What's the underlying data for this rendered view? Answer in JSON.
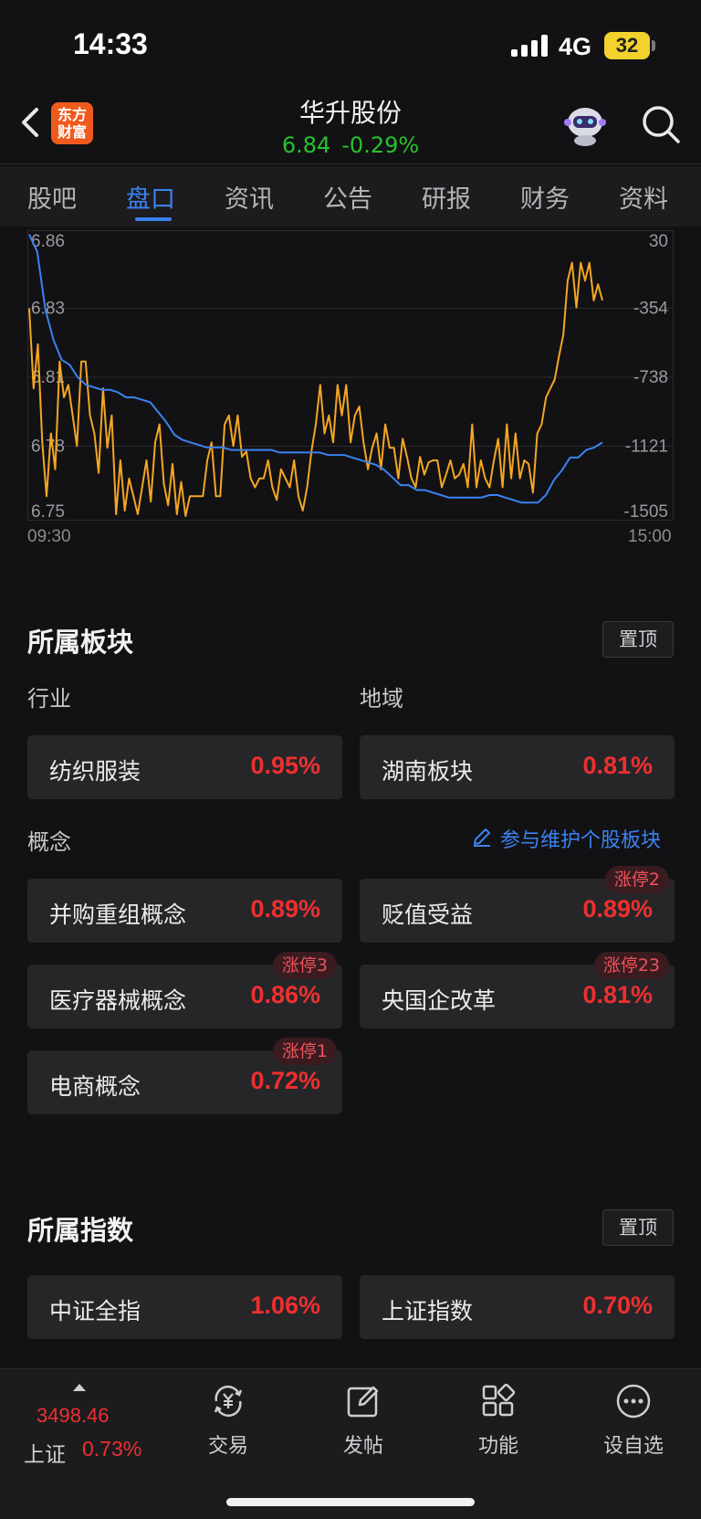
{
  "status_bar": {
    "time": "14:33",
    "network": "4G",
    "battery": "32"
  },
  "header": {
    "logo_line1": "东方",
    "logo_line2": "财富",
    "stock_name": "华升股份",
    "price": "6.84",
    "change_pct": "-0.29%"
  },
  "tabs": [
    "股吧",
    "盘口",
    "资讯",
    "公告",
    "研报",
    "财务",
    "资料"
  ],
  "active_tab": "盘口",
  "chart_data": {
    "type": "line",
    "x_start_label": "09:30",
    "x_end_label": "15:00",
    "left_axis_ticks": [
      "6.86",
      "6.83",
      "6.81",
      "6.78",
      "6.75"
    ],
    "right_axis_ticks": [
      "30",
      "-354",
      "-738",
      "-1121",
      "-1505"
    ],
    "left_range": [
      6.75,
      6.86
    ],
    "right_range": [
      -1505,
      30
    ],
    "grid": true,
    "series": [
      {
        "color": "#f5a623",
        "axis": "right",
        "values": [
          -354,
          -800,
          -554,
          -1100,
          -1400,
          -1050,
          -1250,
          -650,
          -850,
          -780,
          -950,
          -1120,
          -650,
          -650,
          -950,
          -1050,
          -1270,
          -800,
          -1130,
          -950,
          -1500,
          -1200,
          -1480,
          -1300,
          -1400,
          -1500,
          -1350,
          -1200,
          -1430,
          -1100,
          -1000,
          -1330,
          -1450,
          -1220,
          -1500,
          -1320,
          -1510,
          -1400,
          -1400,
          -1400,
          -1400,
          -1200,
          -1100,
          -1400,
          -1400,
          -1000,
          -950,
          -1120,
          -950,
          -1180,
          -1150,
          -1300,
          -1350,
          -1300,
          -1300,
          -1200,
          -1350,
          -1420,
          -1250,
          -1300,
          -1350,
          -1200,
          -1400,
          -1480,
          -1350,
          -1150,
          -1000,
          -780,
          -1050,
          -950,
          -1100,
          -780,
          -950,
          -780,
          -1100,
          -950,
          -900,
          -1100,
          -1250,
          -1130,
          -1050,
          -1250,
          -1000,
          -1130,
          -1130,
          -1300,
          -1080,
          -1180,
          -1300,
          -1350,
          -1180,
          -1280,
          -1210,
          -1200,
          -1200,
          -1350,
          -1280,
          -1200,
          -1300,
          -1280,
          -1220,
          -1350,
          -1000,
          -1350,
          -1200,
          -1300,
          -1350,
          -1200,
          -1080,
          -1350,
          -1000,
          -1300,
          -1050,
          -1300,
          -1200,
          -1220,
          -1380,
          -1050,
          -1000,
          -850,
          -800,
          -750,
          -620,
          -500,
          -200,
          -100,
          -350,
          -100,
          -200,
          -100,
          -310,
          -220,
          -310
        ]
      },
      {
        "color": "#3b82f0",
        "axis": "left",
        "values": [
          6.862,
          6.855,
          6.832,
          6.82,
          6.812,
          6.81,
          6.805,
          6.802,
          6.801,
          6.8,
          6.8,
          6.799,
          6.797,
          6.797,
          6.796,
          6.795,
          6.791,
          6.787,
          6.782,
          6.78,
          6.779,
          6.778,
          6.777,
          6.777,
          6.777,
          6.776,
          6.776,
          6.776,
          6.776,
          6.776,
          6.776,
          6.775,
          6.775,
          6.775,
          6.775,
          6.775,
          6.775,
          6.774,
          6.774,
          6.774,
          6.773,
          6.772,
          6.771,
          6.77,
          6.768,
          6.765,
          6.762,
          6.762,
          6.76,
          6.76,
          6.759,
          6.758,
          6.757,
          6.757,
          6.757,
          6.757,
          6.757,
          6.758,
          6.758,
          6.757,
          6.756,
          6.755,
          6.755,
          6.755,
          6.758,
          6.764,
          6.768,
          6.773,
          6.773,
          6.776,
          6.777,
          6.779
        ]
      }
    ]
  },
  "sectors": {
    "title": "所属板块",
    "pin_label": "置顶",
    "industry_label": "行业",
    "region_label": "地域",
    "industry": {
      "name": "纺织服装",
      "pct": "0.95%"
    },
    "region": {
      "name": "湖南板块",
      "pct": "0.81%"
    },
    "concept_label": "概念",
    "maintain_link": "参与维护个股板块",
    "concepts": [
      {
        "name": "并购重组概念",
        "pct": "0.89%",
        "badge": ""
      },
      {
        "name": "贬值受益",
        "pct": "0.89%",
        "badge": "涨停2"
      },
      {
        "name": "医疗器械概念",
        "pct": "0.86%",
        "badge": "涨停3"
      },
      {
        "name": "央国企改革",
        "pct": "0.81%",
        "badge": "涨停23"
      },
      {
        "name": "电商概念",
        "pct": "0.72%",
        "badge": "涨停1"
      }
    ]
  },
  "indices": {
    "title": "所属指数",
    "pin_label": "置顶",
    "items": [
      {
        "name": "中证全指",
        "pct": "1.06%"
      },
      {
        "name": "上证指数",
        "pct": "0.70%"
      }
    ]
  },
  "bottom_nav": {
    "index_value": "3498.46",
    "index_name": "上证",
    "index_pct": "0.73%",
    "items": [
      "交易",
      "发帖",
      "功能",
      "设自选"
    ]
  }
}
